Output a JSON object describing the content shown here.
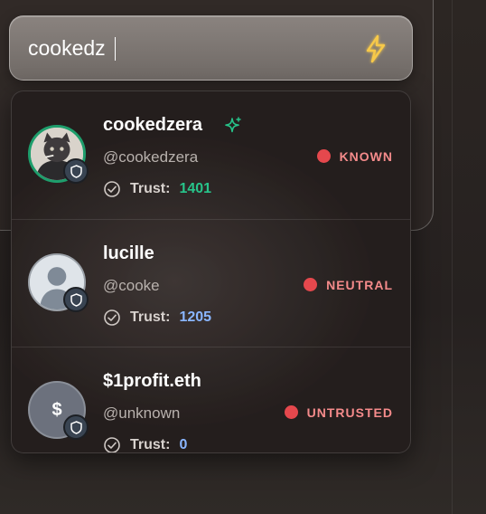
{
  "search": {
    "value": "cookedz",
    "icon": "lightning-bolt-icon",
    "accent": "#f7c948"
  },
  "results": [
    {
      "name": "cookedzera",
      "handle": "@cookedzera",
      "status": "KNOWN",
      "trust_label": "Trust:",
      "trust_value": "1401",
      "trust_color": "#27c48a",
      "verified_icon": "sparkle-icon",
      "avatar": "cat-avatar"
    },
    {
      "name": "lucille",
      "handle": "@cooke",
      "status": "NEUTRAL",
      "trust_label": "Trust:",
      "trust_value": "1205",
      "trust_color": "#8ab6ff",
      "avatar": "default-person-avatar"
    },
    {
      "name": "$1profit.eth",
      "handle": "@unknown",
      "status": "UNTRUSTED",
      "trust_label": "Trust:",
      "trust_value": "0",
      "trust_color": "#8ab6ff",
      "avatar": "dollar-avatar",
      "avatar_text": "$"
    }
  ],
  "colors": {
    "status_dot": "#e5484d",
    "status_text": "#f58b8b",
    "badge_bg": "#394452"
  }
}
